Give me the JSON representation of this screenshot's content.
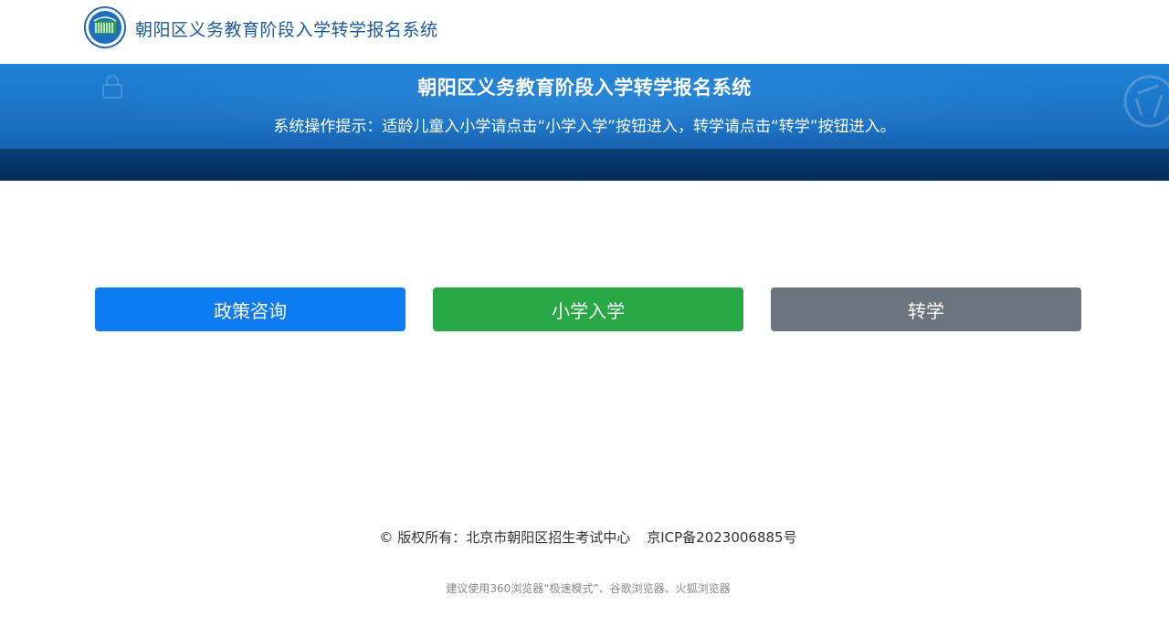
{
  "header": {
    "logo_icon": "education-globe-logo-icon",
    "site_title": "朝阳区义务教育阶段入学转学报名系统"
  },
  "banner": {
    "title": "朝阳区义务教育阶段入学转学报名系统",
    "tip": "系统操作提示：适龄儿童入小学请点击“小学入学”按钮进入，转学请点击“转学”按钮进入。"
  },
  "buttons": [
    {
      "label": "政策咨询",
      "color": "#0d7cf2"
    },
    {
      "label": "小学入学",
      "color": "#28a745"
    },
    {
      "label": "转学",
      "color": "#6c757d"
    }
  ],
  "footer": {
    "copyright_symbol": "©",
    "copyright_text": "版权所有：北京市朝阳区招生考试中心",
    "icp": "京ICP备2023006885号",
    "browser_tip": "建议使用360浏览器“极速模式”、谷歌浏览器、火狐浏览器"
  },
  "colors": {
    "title_blue": "#1e5a99",
    "banner_blue": "#1a6fc0"
  }
}
